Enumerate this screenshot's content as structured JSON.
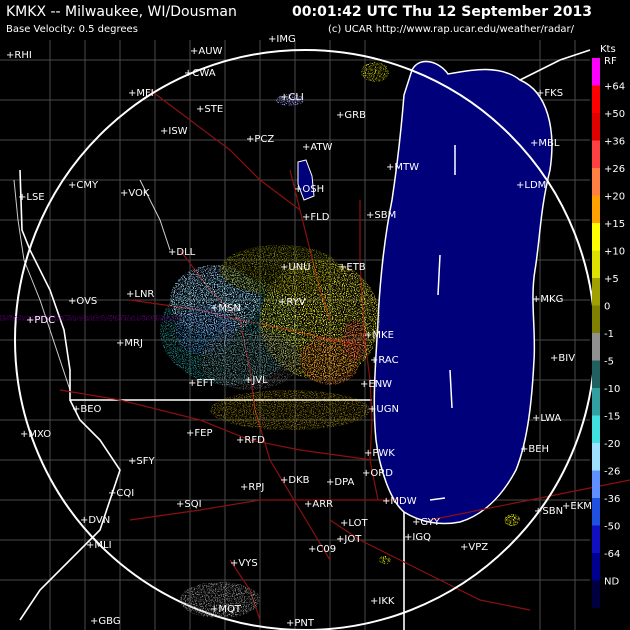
{
  "header": {
    "station": "KMKX -- Milwaukee, WI/Dousman",
    "timestamp": "00:01:42 UTC Thu 12 September 2013",
    "product": "Base Velocity: 0.5 degrees",
    "credit": "(c) UCAR http://www.rap.ucar.edu/weather/radar/"
  },
  "legend": {
    "unit": "Kts",
    "entries": [
      {
        "label": "RF",
        "color": "#ff00ff"
      },
      {
        "label": "+64",
        "color": "#ff0000"
      },
      {
        "label": "+50",
        "color": "#e00000"
      },
      {
        "label": "+36",
        "color": "#ff4040"
      },
      {
        "label": "+26",
        "color": "#ff8040"
      },
      {
        "label": "+20",
        "color": "#ffa000"
      },
      {
        "label": "+15",
        "color": "#ffff00"
      },
      {
        "label": "+10",
        "color": "#e0e000"
      },
      {
        "label": "+5",
        "color": "#a0a000"
      },
      {
        "label": "0",
        "color": "#808000"
      },
      {
        "label": "-1",
        "color": "#909090"
      },
      {
        "label": "-5",
        "color": "#206060"
      },
      {
        "label": "-10",
        "color": "#30a0a0"
      },
      {
        "label": "-15",
        "color": "#40e0e0"
      },
      {
        "label": "-20",
        "color": "#a0e0ff"
      },
      {
        "label": "-26",
        "color": "#6090ff"
      },
      {
        "label": "-36",
        "color": "#2050e0"
      },
      {
        "label": "-50",
        "color": "#1010c0"
      },
      {
        "label": "-64",
        "color": "#000090"
      },
      {
        "label": "ND",
        "color": "#000040"
      }
    ]
  },
  "cities": [
    "RHI",
    "AUW",
    "IMG",
    "CWA",
    "MFI",
    "STE",
    "CLI",
    "GRB",
    "ISW",
    "PCZ",
    "ATW",
    "MTW",
    "CMY",
    "VOK",
    "LSE",
    "OSH",
    "FLD",
    "SBM",
    "DLL",
    "UNU",
    "ETB",
    "LNR",
    "OVS",
    "PDC",
    "MSN",
    "RYV",
    "MKE",
    "MRJ",
    "JVL",
    "RAC",
    "EFT",
    "ENW",
    "UGN",
    "RFD",
    "FEP",
    "MXO",
    "SFY",
    "PWK",
    "ORD",
    "DKB",
    "DPA",
    "RPJ",
    "CQI",
    "SQI",
    "ARR",
    "MDW",
    "GYY",
    "IGQ",
    "LOT",
    "JOT",
    "C09",
    "VPZ",
    "DVN",
    "MLI",
    "VYS",
    "IKK",
    "PNT",
    "GBG",
    "FKS",
    "MBL",
    "LDM",
    "MKG",
    "BIV",
    "LWA",
    "BEH",
    "SBN",
    "EKM",
    "BEO",
    "MQT"
  ],
  "colors": {
    "background": "#000000",
    "lake": "#00007a",
    "county_lines": "#555555",
    "state_lines": "#ffffff",
    "roads": "#8b0000",
    "range_ring": "#ffffff"
  }
}
